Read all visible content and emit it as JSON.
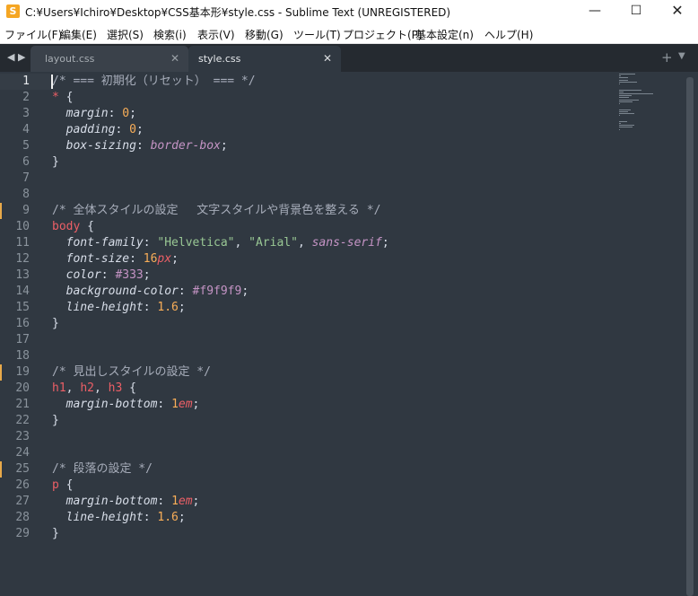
{
  "window": {
    "title": "C:¥Users¥Ichiro¥Desktop¥CSS基本形¥style.css - Sublime Text (UNREGISTERED)",
    "app_icon": "S",
    "controls": {
      "minimize": "—",
      "maximize": "☐",
      "close": "✕"
    }
  },
  "menu": [
    "ファイル(F)",
    "編集(E)",
    "選択(S)",
    "検索(i)",
    "表示(V)",
    "移動(G)",
    "ツール(T)",
    "プロジェクト(P)",
    "基本設定(n)",
    "ヘルプ(H)"
  ],
  "tabs": [
    {
      "label": "layout.css",
      "active": false,
      "close": "✕"
    },
    {
      "label": "style.css",
      "active": true,
      "close": "✕"
    }
  ],
  "tabbar": {
    "nav_left": "◀",
    "nav_right": "▶",
    "new_tab": "+",
    "tab_list": "▼"
  },
  "editor": {
    "current_line": 1,
    "modified_lines": [
      9,
      19,
      25
    ],
    "lines": [
      [
        [
          "/* === 初期化（リセット） === */",
          "comment"
        ]
      ],
      [
        [
          "* ",
          "sel"
        ],
        [
          "{",
          "punc"
        ]
      ],
      [
        [
          "  ",
          "punc"
        ],
        [
          "margin",
          "prop"
        ],
        [
          ": ",
          "punc"
        ],
        [
          "0",
          "num"
        ],
        [
          ";",
          "punc"
        ]
      ],
      [
        [
          "  ",
          "punc"
        ],
        [
          "padding",
          "prop"
        ],
        [
          ": ",
          "punc"
        ],
        [
          "0",
          "num"
        ],
        [
          ";",
          "punc"
        ]
      ],
      [
        [
          "  ",
          "punc"
        ],
        [
          "box-sizing",
          "prop"
        ],
        [
          ": ",
          "punc"
        ],
        [
          "border-box",
          "kw"
        ],
        [
          ";",
          "punc"
        ]
      ],
      [
        [
          "}",
          "punc"
        ]
      ],
      [],
      [],
      [
        [
          "/* 全体スタイルの設定　 文字スタイルや背景色を整える */",
          "comment"
        ]
      ],
      [
        [
          "body ",
          "sel"
        ],
        [
          "{",
          "punc"
        ]
      ],
      [
        [
          "  ",
          "punc"
        ],
        [
          "font-family",
          "prop"
        ],
        [
          ": ",
          "punc"
        ],
        [
          "\"Helvetica\"",
          "str"
        ],
        [
          ", ",
          "punc"
        ],
        [
          "\"Arial\"",
          "str"
        ],
        [
          ", ",
          "punc"
        ],
        [
          "sans-serif",
          "kw"
        ],
        [
          ";",
          "punc"
        ]
      ],
      [
        [
          "  ",
          "punc"
        ],
        [
          "font-size",
          "prop"
        ],
        [
          ": ",
          "punc"
        ],
        [
          "16",
          "num"
        ],
        [
          "px",
          "unit"
        ],
        [
          ";",
          "punc"
        ]
      ],
      [
        [
          "  ",
          "punc"
        ],
        [
          "color",
          "prop"
        ],
        [
          ": ",
          "punc"
        ],
        [
          "#",
          "hash"
        ],
        [
          "333",
          "hash"
        ],
        [
          ";",
          "punc"
        ]
      ],
      [
        [
          "  ",
          "punc"
        ],
        [
          "background-color",
          "prop"
        ],
        [
          ": ",
          "punc"
        ],
        [
          "#",
          "hash"
        ],
        [
          "f9f9f9",
          "hash"
        ],
        [
          ";",
          "punc"
        ]
      ],
      [
        [
          "  ",
          "punc"
        ],
        [
          "line-height",
          "prop"
        ],
        [
          ": ",
          "punc"
        ],
        [
          "1.6",
          "num"
        ],
        [
          ";",
          "punc"
        ]
      ],
      [
        [
          "}",
          "punc"
        ]
      ],
      [],
      [],
      [
        [
          "/* 見出しスタイルの設定 */",
          "comment"
        ]
      ],
      [
        [
          "h1",
          "sel"
        ],
        [
          ", ",
          "punc"
        ],
        [
          "h2",
          "sel"
        ],
        [
          ", ",
          "punc"
        ],
        [
          "h3 ",
          "sel"
        ],
        [
          "{",
          "punc"
        ]
      ],
      [
        [
          "  ",
          "punc"
        ],
        [
          "margin-bottom",
          "prop"
        ],
        [
          ": ",
          "punc"
        ],
        [
          "1",
          "num"
        ],
        [
          "em",
          "unit"
        ],
        [
          ";",
          "punc"
        ]
      ],
      [
        [
          "}",
          "punc"
        ]
      ],
      [],
      [],
      [
        [
          "/* 段落の設定 */",
          "comment"
        ]
      ],
      [
        [
          "p ",
          "sel"
        ],
        [
          "{",
          "punc"
        ]
      ],
      [
        [
          "  ",
          "punc"
        ],
        [
          "margin-bottom",
          "prop"
        ],
        [
          ": ",
          "punc"
        ],
        [
          "1",
          "num"
        ],
        [
          "em",
          "unit"
        ],
        [
          ";",
          "punc"
        ]
      ],
      [
        [
          "  ",
          "punc"
        ],
        [
          "line-height",
          "prop"
        ],
        [
          ": ",
          "punc"
        ],
        [
          "1.6",
          "num"
        ],
        [
          ";",
          "punc"
        ]
      ],
      [
        [
          "}",
          "punc"
        ]
      ]
    ]
  },
  "colors": {
    "editor_bg": "#303841",
    "tabbar_bg": "#252a30",
    "comment": "#a7adba",
    "selector": "#ec5f66",
    "number": "#f9ae58",
    "string": "#99c794",
    "keyword": "#c594c5",
    "modified_marker": "#e8a94a"
  }
}
